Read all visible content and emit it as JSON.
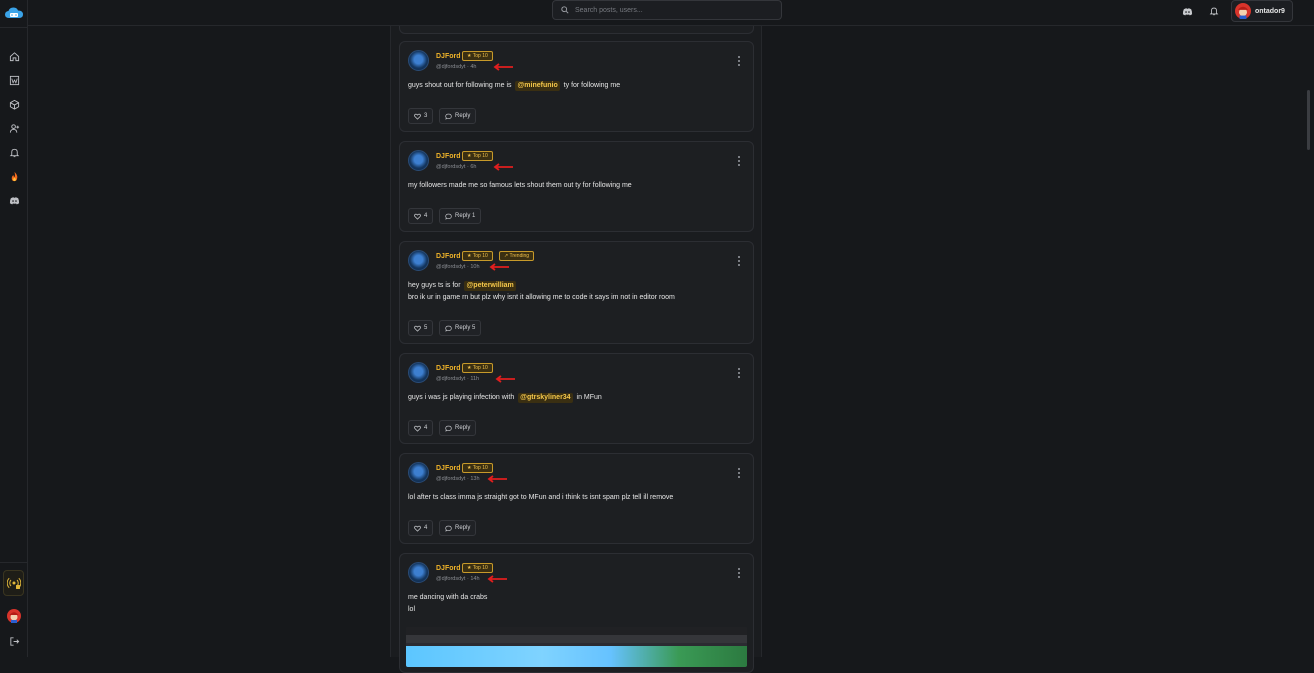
{
  "search": {
    "placeholder": "Search posts, users..."
  },
  "user": {
    "name": "ontador9"
  },
  "rail": {
    "items": [
      "home-icon",
      "wiki-icon",
      "cube-icon",
      "add-user-icon",
      "bell-icon",
      "fire-icon",
      "discord-icon"
    ],
    "bottom": [
      "radio-icon",
      "avatar",
      "logout-icon"
    ]
  },
  "colors": {
    "accent": "#f0b429",
    "arrow": "#e01e1e",
    "background": "#16181b"
  },
  "posts": [
    {
      "author": "DJFord",
      "handle": "@djfordsdyt",
      "age": "4h",
      "badges": [
        "★ Top 10"
      ],
      "lines": [
        [
          "guys shout out for following me is ",
          "@minefunio",
          " ty for following me"
        ]
      ],
      "likes": "3",
      "reply_label": "Reply"
    },
    {
      "author": "DJFord",
      "handle": "@djfordsdyt",
      "age": "6h",
      "badges": [
        "★ Top 10"
      ],
      "lines": [
        [
          "my followers made me so famous lets shout them out ty for following me"
        ]
      ],
      "likes": "4",
      "reply_label": "Reply 1"
    },
    {
      "author": "DJFord",
      "handle": "@djfordsdyt",
      "age": "10h",
      "badges": [
        "★ Top 10",
        "↗ Trending"
      ],
      "lines": [
        [
          "hey guys ts is for ",
          "@peterwilliam"
        ],
        [
          "bro ik ur in game rn but plz why isnt it allowing me to code it says im not in editor room"
        ]
      ],
      "likes": "5",
      "reply_label": "Reply 5"
    },
    {
      "author": "DJFord",
      "handle": "@djfordsdyt",
      "age": "11h",
      "badges": [
        "★ Top 10"
      ],
      "lines": [
        [
          "guys i was js playing infection with ",
          "@gtrskyliner34",
          " in MFun"
        ]
      ],
      "likes": "4",
      "reply_label": "Reply"
    },
    {
      "author": "DJFord",
      "handle": "@djfordsdyt",
      "age": "13h",
      "badges": [
        "★ Top 10"
      ],
      "lines": [
        [
          "lol after ts class imma js straight got to MFun and i think ts isnt spam plz tell ill remove"
        ]
      ],
      "likes": "4",
      "reply_label": "Reply"
    },
    {
      "author": "DJFord",
      "handle": "@djfordsdyt",
      "age": "14h",
      "badges": [
        "★ Top 10"
      ],
      "lines": [
        [
          "me dancing with da crabs"
        ],
        [
          "lol"
        ]
      ],
      "likes": "",
      "reply_label": ""
    }
  ]
}
